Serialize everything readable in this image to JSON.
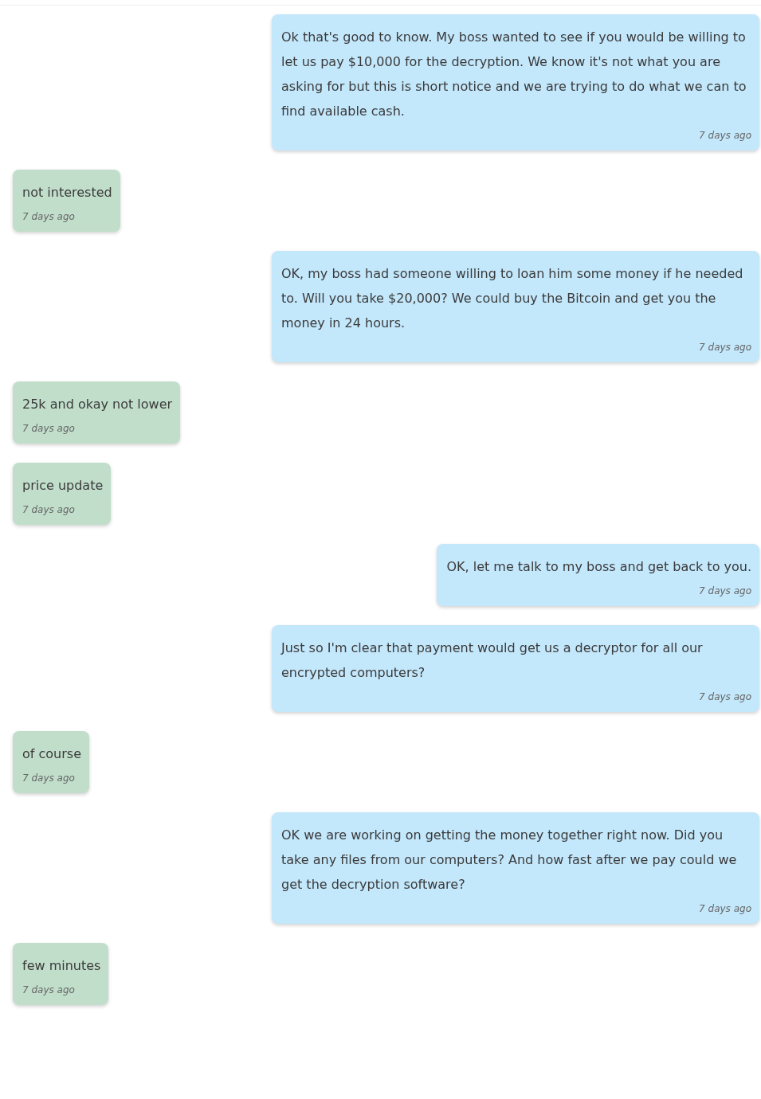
{
  "messages": [
    {
      "kind": "sent",
      "text": "Ok that's good to know. My boss wanted to see if you would be willing to let us pay $10,000 for the decryption. We know it's not what you are asking for but this is short notice and we are trying to do what we can to find available cash.",
      "time": "7 days ago"
    },
    {
      "kind": "received",
      "text": "not interested",
      "time": "7 days ago"
    },
    {
      "kind": "sent",
      "text": "OK, my boss had someone willing to loan him some money if he needed to. Will you take $20,000? We could buy the Bitcoin and get you the money in 24 hours.",
      "time": "7 days ago"
    },
    {
      "kind": "received",
      "text": "25k and okay not lower",
      "time": "7 days ago"
    },
    {
      "kind": "received",
      "text": "price update",
      "time": "7 days ago"
    },
    {
      "kind": "sent",
      "text": "OK, let me talk to my boss and get back to you.",
      "time": "7 days ago"
    },
    {
      "kind": "sent",
      "text": "Just so I'm clear that payment would get us a decryptor for all our encrypted computers?",
      "time": "7 days ago"
    },
    {
      "kind": "received",
      "text": "of course",
      "time": "7 days ago"
    },
    {
      "kind": "sent",
      "text": "OK we are working on getting the money together right now. Did you take any files from our computers? And how fast after we pay could we get the decryption software?",
      "time": "7 days ago"
    },
    {
      "kind": "received",
      "text": "few minutes",
      "time": "7 days ago"
    }
  ]
}
